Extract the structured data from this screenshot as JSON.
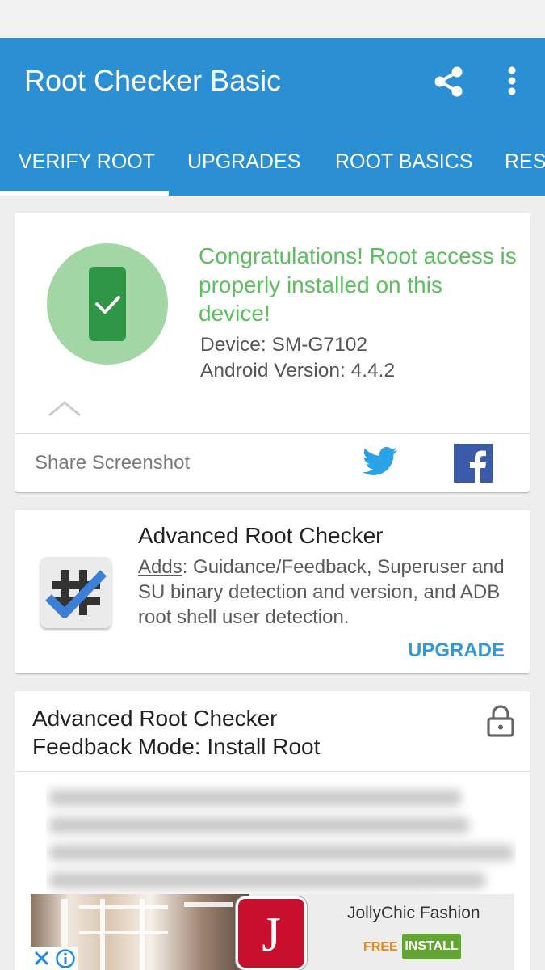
{
  "app_bar": {
    "title": "Root Checker Basic",
    "background_color": "#2b8fd3",
    "actions": [
      {
        "icon": "share-icon"
      },
      {
        "icon": "more-vert-icon"
      }
    ]
  },
  "tabs": [
    {
      "label": "VERIFY ROOT",
      "selected": true
    },
    {
      "label": "UPGRADES",
      "selected": false
    },
    {
      "label": "ROOT BASICS",
      "selected": false
    },
    {
      "label": "RES",
      "selected": false
    }
  ],
  "verify_card": {
    "status_icon": "phone-check-icon",
    "message": "Congratulations! Root access is properly installed on this device!",
    "message_color": "#5cbf5e",
    "device": "Device: SM-G7102",
    "android_version": "Android Version: 4.4.2",
    "collapse_icon": "chevron-up-icon",
    "share_label": "Share Screenshot",
    "share_targets": [
      {
        "icon": "twitter-icon",
        "color": "#1da1f2"
      },
      {
        "icon": "facebook-icon",
        "color": "#3b5998"
      }
    ]
  },
  "upgrade_card": {
    "icon": "root-checker-pro-icon",
    "title": "Advanced Root Checker",
    "desc_prefix": "Adds",
    "desc_body": ": Guidance/Feedback, Superuser and SU binary detection and version, and ADB root shell user detection.",
    "action_label": "UPGRADE",
    "action_color": "#3399d6"
  },
  "feedback_card": {
    "title_line1": "Advanced Root Checker",
    "title_line2": "Feedback Mode: Install Root",
    "lock_icon": "lock-icon"
  },
  "ad": {
    "logo_letter": "J",
    "title": "JollyChic Fashion",
    "price": "FREE",
    "install_label": "INSTALL",
    "close_icon": "close-icon",
    "info_icon": "info-icon"
  }
}
